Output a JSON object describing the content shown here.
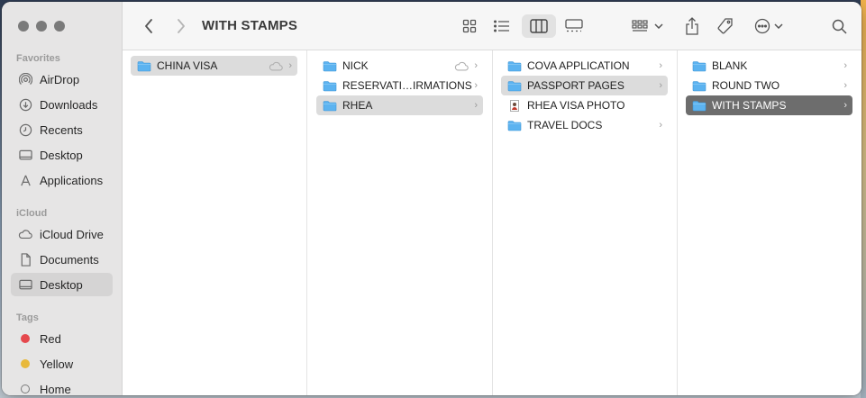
{
  "window": {
    "title": "WITH STAMPS"
  },
  "sidebar": {
    "sections": {
      "favorites": "Favorites",
      "icloud": "iCloud",
      "tags": "Tags"
    },
    "favorites": [
      {
        "label": "AirDrop",
        "icon": "airdrop-icon"
      },
      {
        "label": "Downloads",
        "icon": "download-icon"
      },
      {
        "label": "Recents",
        "icon": "clock-icon"
      },
      {
        "label": "Desktop",
        "icon": "desktop-icon"
      },
      {
        "label": "Applications",
        "icon": "applications-icon"
      }
    ],
    "icloud": [
      {
        "label": "iCloud Drive",
        "icon": "cloud-icon"
      },
      {
        "label": "Documents",
        "icon": "document-icon"
      },
      {
        "label": "Desktop",
        "icon": "desktop-icon",
        "selected": true
      }
    ],
    "tags": [
      {
        "label": "Red",
        "color": "#e5484d"
      },
      {
        "label": "Yellow",
        "color": "#e8b93b"
      },
      {
        "label": "Home",
        "color": "ring"
      }
    ]
  },
  "columns": [
    {
      "items": [
        {
          "label": "CHINA VISA",
          "type": "folder",
          "selected": "grey",
          "cloud": true
        }
      ]
    },
    {
      "items": [
        {
          "label": "NICK",
          "type": "folder",
          "cloud": true
        },
        {
          "label": "RESERVATI…IRMATIONS",
          "type": "folder"
        },
        {
          "label": "RHEA",
          "type": "folder",
          "selected": "grey"
        }
      ]
    },
    {
      "items": [
        {
          "label": "COVA APPLICATION",
          "type": "folder"
        },
        {
          "label": "PASSPORT PAGES",
          "type": "folder",
          "selected": "grey"
        },
        {
          "label": "RHEA VISA PHOTO",
          "type": "image"
        },
        {
          "label": "TRAVEL DOCS",
          "type": "folder"
        }
      ]
    },
    {
      "items": [
        {
          "label": "BLANK",
          "type": "folder"
        },
        {
          "label": "ROUND TWO",
          "type": "folder"
        },
        {
          "label": "WITH STAMPS",
          "type": "folder",
          "selected": "dark"
        }
      ]
    }
  ],
  "colors": {
    "folder": "#5cb3f0",
    "selection_dark": "#6d6d6d",
    "selection_grey": "#dcdcdc"
  }
}
